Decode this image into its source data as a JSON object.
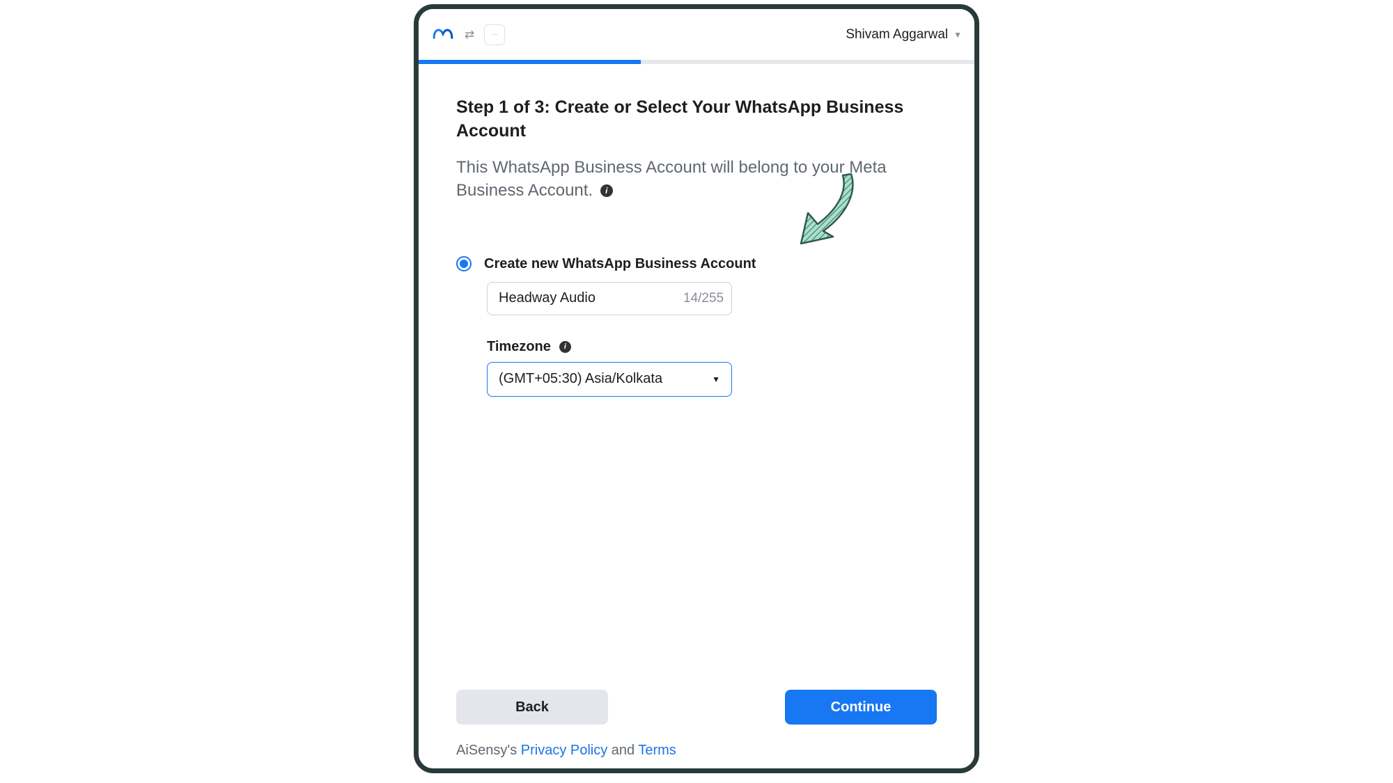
{
  "header": {
    "user_name": "Shivam Aggarwal"
  },
  "progress": {
    "percent": 40
  },
  "page": {
    "title": "Step 1 of 3: Create or Select Your WhatsApp Business Account",
    "subtitle": "This WhatsApp Business Account will belong to your Meta Business Account."
  },
  "option": {
    "label": "Create new WhatsApp Business Account",
    "input_value": "Headway Audio",
    "char_count": "14/255"
  },
  "timezone": {
    "label": "Timezone",
    "selected": "(GMT+05:30) Asia/Kolkata"
  },
  "buttons": {
    "back": "Back",
    "continue": "Continue"
  },
  "footer": {
    "prefix": "AiSensy's ",
    "privacy": "Privacy Policy",
    "mid": " and ",
    "terms": "Terms"
  }
}
